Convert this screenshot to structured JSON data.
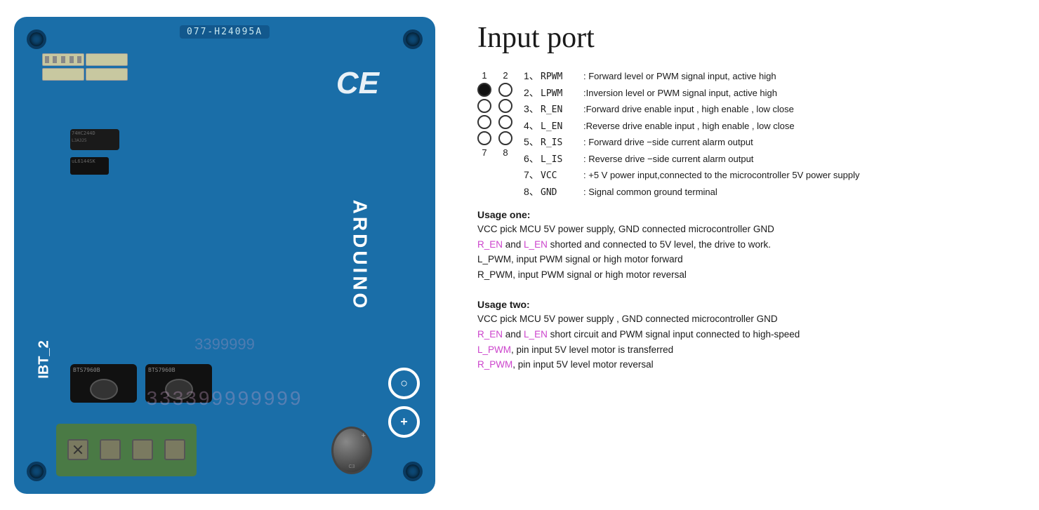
{
  "board": {
    "label": "077-H24095A",
    "ce_mark": "CE",
    "arduino_text": "ARDUINO",
    "ibt_text": "IBT_2",
    "watermark": "333399999999"
  },
  "header": {
    "title": "Input port"
  },
  "connector": {
    "col_labels": [
      "1",
      "2"
    ],
    "row_bottom_labels": [
      "7",
      "8"
    ],
    "rows": [
      {
        "left_filled": true,
        "right_filled": false
      },
      {
        "left_filled": false,
        "right_filled": false
      },
      {
        "left_filled": false,
        "right_filled": false
      },
      {
        "left_filled": false,
        "right_filled": false
      }
    ]
  },
  "pins": [
    {
      "num": "1、",
      "name": "RPWM",
      "desc": ": Forward level or PWM signal input, active high"
    },
    {
      "num": "2、",
      "name": "LPWM",
      "desc": ":Inversion level or PWM signal input, active high"
    },
    {
      "num": "3、",
      "name": "R_EN",
      "desc": ":Forward drive enable input , high enable , low close"
    },
    {
      "num": "4、",
      "name": "L_EN",
      "desc": ":Reverse drive enable input , high enable , low close"
    },
    {
      "num": "5、",
      "name": "R_IS",
      "desc": ": Forward drive −side current alarm output"
    },
    {
      "num": "6、",
      "name": "L_IS",
      "desc": ": Reverse drive −side current alarm output"
    },
    {
      "num": "7、",
      "name": "VCC",
      "desc": ": +5 V power input,connected to the microcontroller 5V power supply"
    },
    {
      "num": "8、",
      "name": "GND",
      "desc": ": Signal common ground terminal"
    }
  ],
  "usage_one": {
    "title": "Usage one:",
    "lines": [
      "VCC pick MCU 5V power supply, GND connected microcontroller GND",
      "R_EN and L_EN shorted and connected to 5V level, the drive to work.",
      "L_PWM, input PWM signal or high motor forward",
      "R_PWM, input PWM signal or high motor reversal"
    ]
  },
  "usage_two": {
    "title": "Usage two:",
    "lines": [
      "VCC pick MCU 5V power supply , GND connected microcontroller GND",
      "R_EN and L_EN short circuit and PWM signal input connected to high-speed",
      "L_PWM, pin input 5V level motor is transferred",
      "R_PWM, pin input 5V level motor reversal"
    ]
  }
}
